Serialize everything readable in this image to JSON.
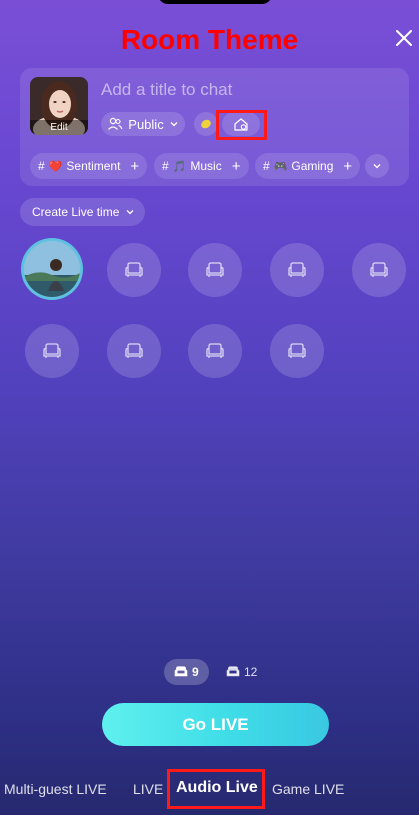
{
  "annotation": {
    "title": "Room Theme"
  },
  "card": {
    "avatar_edit_label": "Edit",
    "title_placeholder": "Add a title to chat",
    "visibility_label": "Public",
    "tags": [
      {
        "hash": "#",
        "emoji": "❤️",
        "label": "Sentiment",
        "add": "+"
      },
      {
        "hash": "#",
        "emoji": "🎵",
        "label": "Music",
        "add": "+"
      },
      {
        "hash": "#",
        "emoji": "🎮",
        "label": "Gaming",
        "add": "+"
      }
    ]
  },
  "live_time_label": "Create Live time",
  "seats": {
    "host_present": true,
    "empty_seat_icon": "armchair-icon"
  },
  "counts": {
    "active": "9",
    "other": "12"
  },
  "go_live_label": "Go LIVE",
  "modes": [
    {
      "label": "Multi-guest LIVE",
      "active": false
    },
    {
      "label": "LIVE",
      "active": false
    },
    {
      "label": "Audio Live",
      "active": true
    },
    {
      "label": "Game LIVE",
      "active": false
    }
  ],
  "colors": {
    "annotation_red": "#ff0000",
    "go_live_start": "#5ff0ee",
    "go_live_end": "#39c8e2"
  }
}
